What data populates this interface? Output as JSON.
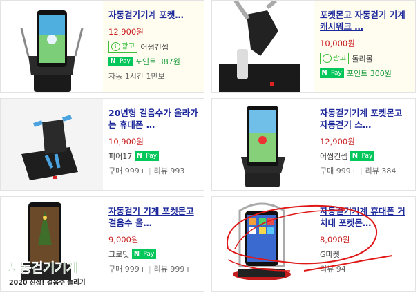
{
  "products": [
    {
      "title": "자동걷기기계 포켓…",
      "price": "12,900원",
      "ad_label": "광고",
      "seller": "어썸컨셉",
      "npay_n": "N",
      "npay_p": "Pay",
      "points": "포인트 387원",
      "meta": "자동 1시간 1만보"
    },
    {
      "title": "포켓몬고 자동걷기 기계 캐시워크 …",
      "price": "10,000원",
      "ad_label": "광고",
      "seller": "돌리몰",
      "npay_n": "N",
      "npay_p": "Pay",
      "points": "포인트 300원"
    },
    {
      "title": "20년형 걸음수가 올라가는 휴대폰 …",
      "price": "10,900원",
      "seller": "피어17",
      "npay_n": "N",
      "npay_p": "Pay",
      "purchase": "구매 999+",
      "review": "리뷰 993"
    },
    {
      "title": "자동걷기기계 포켓몬고 자동걷기 스…",
      "price": "12,900원",
      "seller": "어썸컨셉",
      "npay_n": "N",
      "npay_p": "Pay",
      "purchase": "구매 999+",
      "review": "리뷰 384"
    },
    {
      "title": "자동걷기 기계 포켓몬고 걸음수 올…",
      "price": "9,000원",
      "seller": "그로밋",
      "npay_n": "N",
      "npay_p": "Pay",
      "purchase": "구매 999+",
      "review": "리뷰 999+",
      "image_caption_big": "자동걷기기계",
      "image_caption_small": "2020 신상! 걸음수 늘리기"
    },
    {
      "title": "자동걷기기계 휴대폰 거치대 포켓몬…",
      "price": "8,090원",
      "seller": "G마켓",
      "review": "리뷰 94"
    }
  ],
  "colors": {
    "title": "#1e2a9c",
    "price": "#c81e1e",
    "npay": "#03c75a",
    "annotation": "#e01818"
  }
}
